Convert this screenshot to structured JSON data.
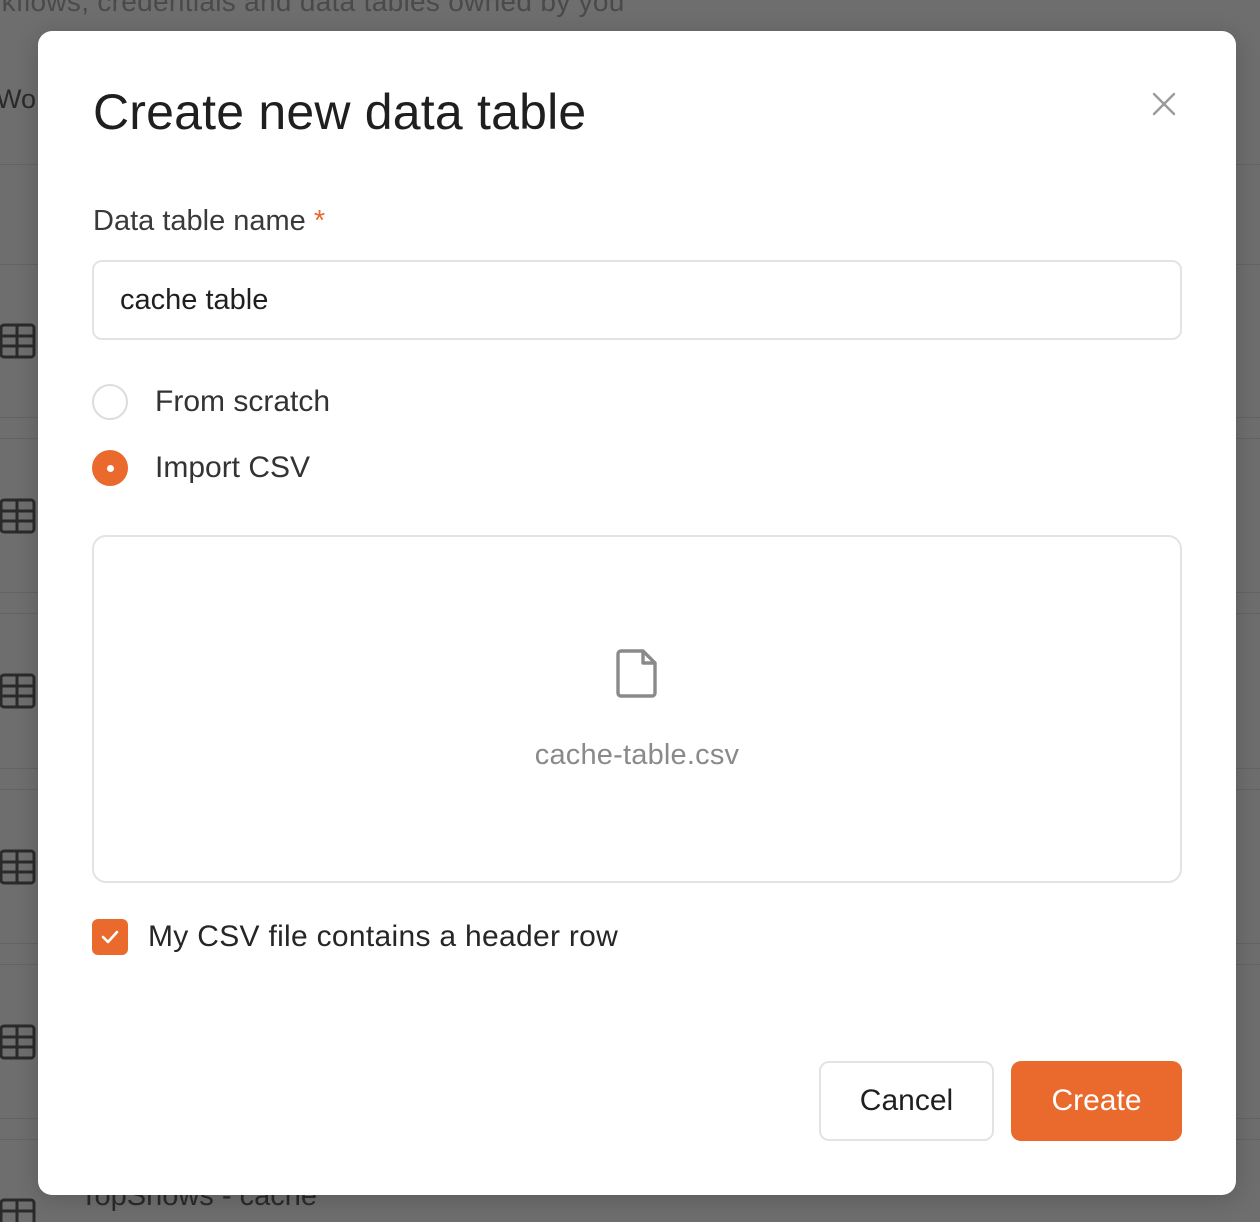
{
  "background": {
    "subtitle": "rkflows, credentials and data tables owned by you",
    "column_head": "Wo",
    "last_row_name": "TopShows - cache"
  },
  "modal": {
    "title": "Create new data table",
    "name_field": {
      "label": "Data table name",
      "required_mark": "*",
      "value": "cache table"
    },
    "source_options": [
      {
        "label": "From scratch",
        "checked": false
      },
      {
        "label": "Import CSV",
        "checked": true
      }
    ],
    "dropzone": {
      "file_icon": "file-icon",
      "file_name": "cache-table.csv"
    },
    "header_row_checkbox": {
      "label": "My CSV file contains a header row",
      "checked": true
    },
    "buttons": {
      "cancel": "Cancel",
      "create": "Create"
    }
  },
  "colors": {
    "accent": "#ea6a2e",
    "overlay": "#6e6e6e"
  }
}
